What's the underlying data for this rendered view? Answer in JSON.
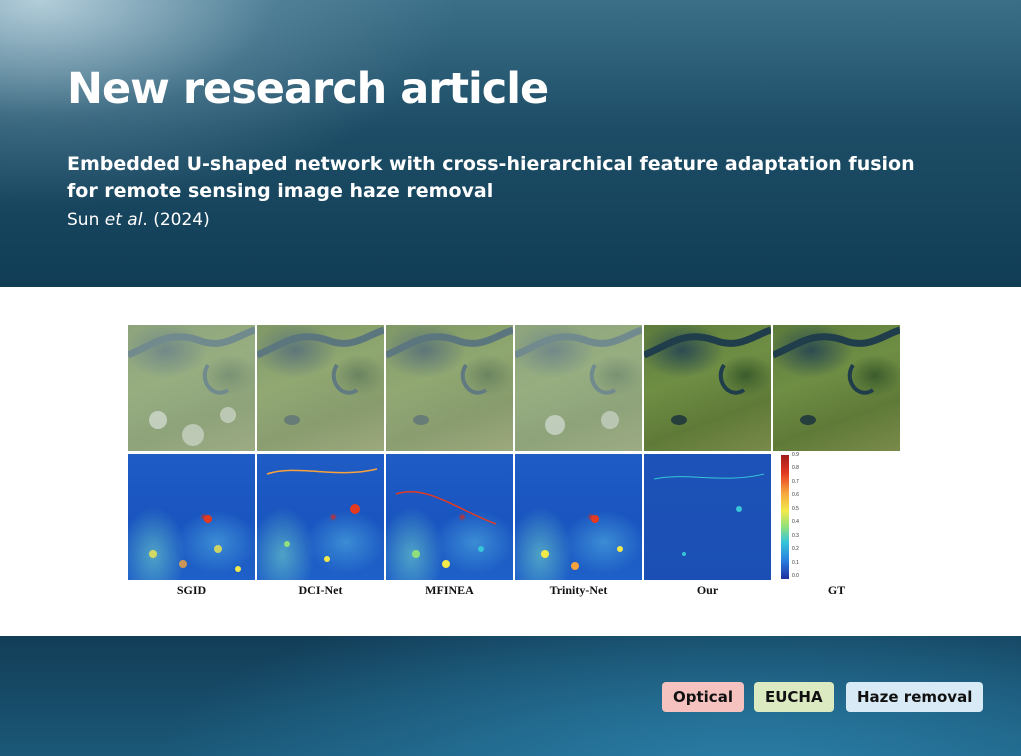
{
  "header": {
    "headline": "New research article",
    "title": "Embedded U-shaped network with cross-hierarchical feature adaptation fusion for remote sensing image haze removal",
    "authors": {
      "name": "Sun",
      "etal": "et al",
      "year": ". (2024)"
    }
  },
  "figure": {
    "columns": [
      "SGID",
      "DCI-Net",
      "MFINEA",
      "Trinity-Net",
      "Our",
      "GT"
    ],
    "colorbar_ticks": [
      "0.9",
      "0.8",
      "0.7",
      "0.6",
      "0.5",
      "0.4",
      "0.3",
      "0.2",
      "0.1",
      "0.0"
    ]
  },
  "tags": [
    {
      "label": "Optical",
      "color": "#f5c2c0"
    },
    {
      "label": "EUCHA",
      "color": "#dbeac0"
    },
    {
      "label": "Haze removal",
      "color": "#d7eaf5"
    }
  ]
}
